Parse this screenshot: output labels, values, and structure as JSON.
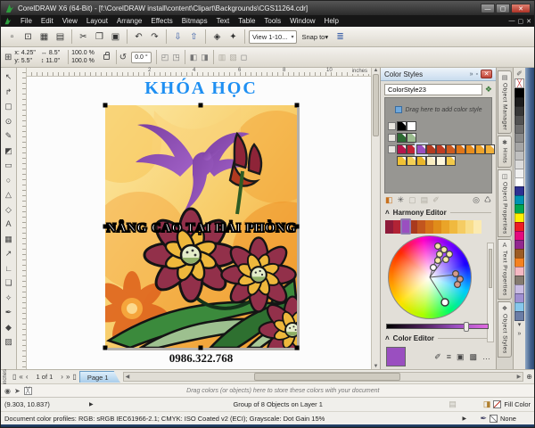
{
  "window": {
    "title": "CorelDRAW X6 (64-Bit) - [f:\\CorelDRAW install\\content\\Clipart\\Backgrounds\\CGS11264.cdr]",
    "menus": [
      "File",
      "Edit",
      "View",
      "Layout",
      "Arrange",
      "Effects",
      "Bitmaps",
      "Text",
      "Table",
      "Tools",
      "Window",
      "Help"
    ],
    "buttons": {
      "min": "—",
      "max": "▢",
      "close": "✕"
    }
  },
  "toolbar": {
    "buttons": [
      "▫",
      "⊡",
      "▦",
      "▤",
      "✂",
      "❐",
      "▣",
      "↶",
      "↷",
      "⇩",
      "⇧",
      "◈",
      "✦"
    ],
    "view_dropdown": "View 1-10...",
    "snap_label": "Snap to",
    "options_icon": "≣",
    "caret": "▾"
  },
  "propbar": {
    "pos_icon": "⊞",
    "x_label": "x:",
    "x_value": "4.25\"",
    "y_label": "y:",
    "y_value": "5.5\"",
    "w_icon": "↔",
    "w_value": "8.5\"",
    "h_icon": "↕",
    "h_value": "11.0\"",
    "scale_x": "100.0",
    "scale_y": "100.0",
    "pct": "%",
    "rot_icon": "↺",
    "rot_value": "0.0",
    "deg": "°",
    "extra_icons": [
      "◰",
      "◳",
      "◧",
      "◨",
      "▥",
      "▧",
      "◻"
    ]
  },
  "ruler": {
    "unit": "inches",
    "h_numbers": [
      "2",
      "4",
      "6",
      "8",
      "10"
    ]
  },
  "toolbox": {
    "tools": [
      {
        "n": "pick-tool",
        "g": "↖"
      },
      {
        "n": "shape-tool",
        "g": "↱"
      },
      {
        "n": "crop-tool",
        "g": "▢"
      },
      {
        "n": "zoom-tool",
        "g": "⊙"
      },
      {
        "n": "freehand-tool",
        "g": "✎"
      },
      {
        "n": "smart-fill-tool",
        "g": "◩"
      },
      {
        "n": "rectangle-tool",
        "g": "▭"
      },
      {
        "n": "ellipse-tool",
        "g": "○"
      },
      {
        "n": "polygon-tool",
        "g": "△"
      },
      {
        "n": "basic-shapes-tool",
        "g": "◇"
      },
      {
        "n": "text-tool",
        "g": "A"
      },
      {
        "n": "table-tool",
        "g": "▦"
      },
      {
        "n": "dimension-tool",
        "g": "↗"
      },
      {
        "n": "connector-tool",
        "g": "∟"
      },
      {
        "n": "effects-tool",
        "g": "❏"
      },
      {
        "n": "eyedropper-tool",
        "g": "✧"
      },
      {
        "n": "outline-pen-tool",
        "g": "✒"
      },
      {
        "n": "fill-tool",
        "g": "◆"
      },
      {
        "n": "interactive-fill-tool",
        "g": "▨"
      }
    ]
  },
  "canvas": {
    "heading": "KHÓA HỌC",
    "heading_color": "#1e8ff2",
    "overlay": "NÂNG CAO TẠI HẢI PHÒNG",
    "phone": "0986.322.768"
  },
  "docker": {
    "title": "Color Styles",
    "chevron": "»",
    "pin": "▫",
    "close": "✕",
    "style_name": "ColorStyle23",
    "add_style_icon": "❖",
    "drag_hint": "Drag here to add color style",
    "swatch_row1": [
      "#000000",
      "#ffffff"
    ],
    "swatch_row2": [
      "#2d6b33",
      "#9cbc90"
    ],
    "swatch_row3": [
      "#b5154c",
      "#c02334",
      "#9a4fc0",
      "#b23a20",
      "#bf3c22",
      "#cd5a1e",
      "#de7619",
      "#e68d1d",
      "#eda32b",
      "#f0b03a"
    ],
    "swatch_row4": [
      "#f0c235",
      "#f3cf55",
      "#e9b62a",
      "#f8ecc0",
      "#fdf7dd",
      "#f2c94a"
    ],
    "toolbar_icons": [
      "◧",
      "✳",
      "▢",
      "▤",
      "✐",
      "◎",
      "♺"
    ],
    "harmony_header": "Harmony Editor",
    "harmony_colors": [
      "#8e1b3a",
      "#b22335",
      "#9a4fc0",
      "#a93a1e",
      "#c2551e",
      "#d5721a",
      "#e08c1a",
      "#eaa428",
      "#f0b93f",
      "#f5cc63",
      "#f8dd8a",
      "#fbeab1"
    ],
    "collapse_icon": "˄",
    "color_editor_header": "Color Editor",
    "editor_color": "#9a4fc0",
    "editor_icons": [
      "✐",
      "≡",
      "▣",
      "▩",
      "…"
    ]
  },
  "tabs": {
    "items": [
      {
        "icon": "▤",
        "label": "Object Manager"
      },
      {
        "icon": "✱",
        "label": "Hints"
      },
      {
        "icon": "◫",
        "label": "Object Properties"
      },
      {
        "icon": "A",
        "label": "Text Properties"
      },
      {
        "icon": "❖",
        "label": "Object Styles"
      }
    ],
    "active": {
      "icon": "◧",
      "label": "Color Styles",
      "close": "✕"
    }
  },
  "palette": {
    "eyedropper_icon": "✐",
    "none_glyph": "╳",
    "colors": [
      "#000000",
      "#1c1c1c",
      "#373737",
      "#525252",
      "#6e6e6e",
      "#8a8a8a",
      "#a5a5a5",
      "#c0c0c0",
      "#dbdbdb",
      "#f0f0f0",
      "#ffffff",
      "#2e3192",
      "#0093b2",
      "#00a651",
      "#ffef00",
      "#ed1c24",
      "#e5097f",
      "#92278f",
      "#9c5c24",
      "#f58220",
      "#f5b8c3",
      "#847a6f",
      "#c9bce4",
      "#9f8fd1",
      "#86c7ec",
      "#6b7da6"
    ],
    "down_arrow": "▾",
    "flyout": "»"
  },
  "pagenav": {
    "page_icon": "▯",
    "first": "«",
    "prev": "‹",
    "info": "1 of 1",
    "next": "›",
    "last": "»",
    "add_icon": "▯",
    "tab": "Page 1",
    "zoom_icon": "⊕"
  },
  "docpal": {
    "flyout_icon": "◉",
    "marker_icon": "➤",
    "none_glyph": "╳",
    "hint": "Drag colors (or objects) here to store these colors with your document"
  },
  "status": {
    "coords": "(9.303, 10.837)",
    "arrow": "▶",
    "selection": "Group of 8 Objects on Layer 1",
    "meter_icon": "▤",
    "fill_icon": "◨",
    "fill_label": "Fill Color",
    "outline_icon": "✒",
    "none_label": "None",
    "profiles": "Document color profiles: RGB: sRGB IEC61966-2.1; CMYK: ISO Coated v2 (ECI); Grayscale: Dot Gain 15%"
  }
}
